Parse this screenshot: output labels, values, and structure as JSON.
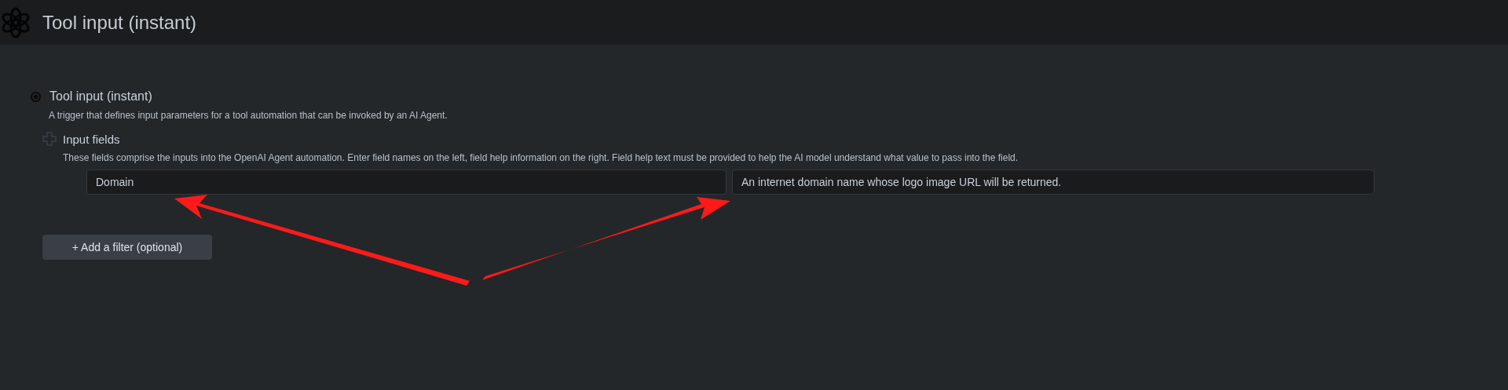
{
  "header": {
    "title": "Tool input (instant)"
  },
  "trigger": {
    "title": "Tool input (instant)",
    "description": "A trigger that defines input parameters for a tool automation that can be invoked by an AI Agent."
  },
  "input_fields": {
    "title": "Input fields",
    "help": "These fields comprise the inputs into the OpenAI Agent automation.  Enter field names on the left, field help information on the right. Field help text must be provided to help the AI model understand what value to pass into the field.",
    "rows": [
      {
        "name": "Domain",
        "help": "An internet domain name whose logo image URL will be returned."
      }
    ]
  },
  "add_filter_button": "+ Add a filter (optional)"
}
